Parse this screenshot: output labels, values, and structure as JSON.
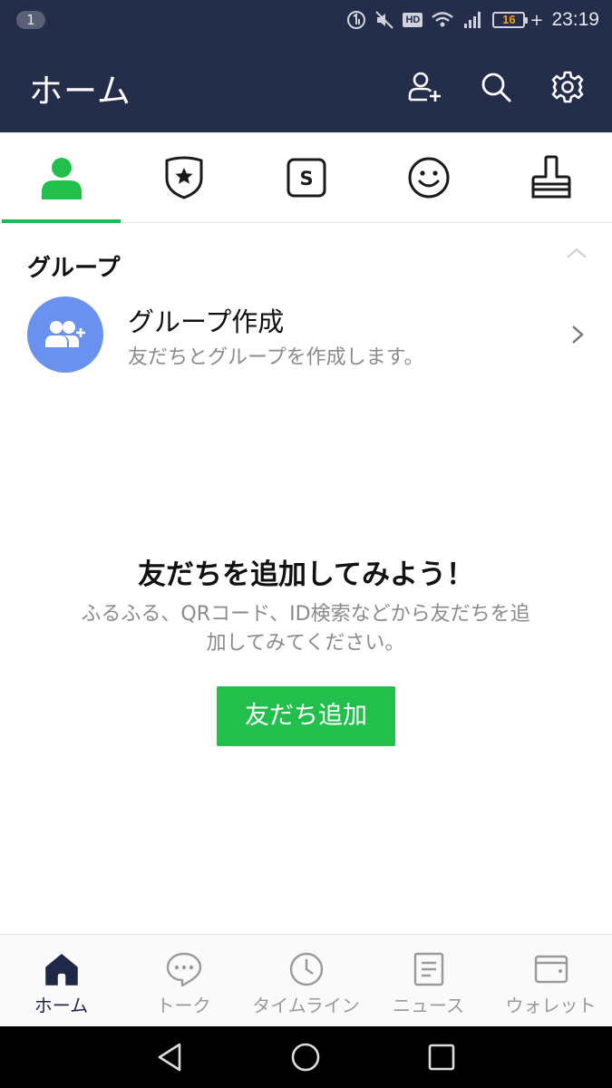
{
  "status_bar": {
    "notification_count": "1",
    "battery_level": "16",
    "battery_charging_symbol": "+",
    "hd_label": "HD",
    "time": "23:19",
    "icons": [
      "data-saver-icon",
      "mute-icon",
      "hd-icon",
      "wifi-icon",
      "signal-icon",
      "battery-icon"
    ]
  },
  "header": {
    "title": "ホーム",
    "actions": [
      "add-friend-icon",
      "search-icon",
      "settings-icon"
    ]
  },
  "tabs": [
    {
      "icon": "friends-icon",
      "active": true
    },
    {
      "icon": "official-account-icon",
      "active": false
    },
    {
      "icon": "sticker-shop-icon",
      "active": false
    },
    {
      "icon": "emoji-icon",
      "active": false
    },
    {
      "icon": "theme-icon",
      "active": false
    }
  ],
  "group_section": {
    "title": "グループ",
    "create": {
      "name": "グループ作成",
      "description": "友だちとグループを作成します。"
    }
  },
  "empty_state": {
    "title": "友だちを追加してみよう！",
    "description": "ふるふる、QRコード、ID検索などから友だちを追加してみてください。",
    "button_label": "友だち追加"
  },
  "bottom_nav": {
    "items": [
      {
        "label": "ホーム",
        "icon": "home-icon",
        "active": true
      },
      {
        "label": "トーク",
        "icon": "chat-icon",
        "active": false
      },
      {
        "label": "タイムライン",
        "icon": "clock-icon",
        "active": false
      },
      {
        "label": "ニュース",
        "icon": "news-icon",
        "active": false
      },
      {
        "label": "ウォレット",
        "icon": "wallet-icon",
        "active": false
      }
    ]
  },
  "colors": {
    "header_bg": "#242d49",
    "accent_green": "#23bf4d",
    "group_avatar": "#6a91ee",
    "battery_text": "#f0a21b"
  }
}
